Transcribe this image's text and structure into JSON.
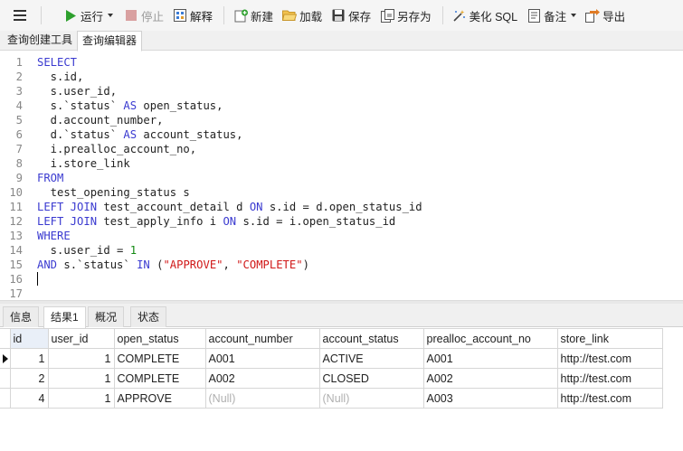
{
  "toolbar": {
    "menu_icon": "hamburger-menu-icon",
    "run_label": "运行",
    "stop_label": "停止",
    "explain_label": "解释",
    "new_label": "新建",
    "load_label": "加载",
    "save_label": "保存",
    "save_as_label": "另存为",
    "beautify_label": "美化 SQL",
    "comment_label": "备注",
    "export_label": "导出"
  },
  "tabs": {
    "builder": "查询创建工具",
    "editor": "查询编辑器"
  },
  "editor": {
    "line_numbers": [
      "1",
      "2",
      "3",
      "4",
      "5",
      "6",
      "7",
      "8",
      "9",
      "10",
      "11",
      "12",
      "13",
      "14",
      "15",
      "16",
      "17"
    ],
    "lines": [
      [
        {
          "t": "SELECT",
          "c": "kw"
        }
      ],
      [
        {
          "t": "  s.id,",
          "c": ""
        }
      ],
      [
        {
          "t": "  s.user_id,",
          "c": ""
        }
      ],
      [
        {
          "t": "  s.`status` ",
          "c": ""
        },
        {
          "t": "AS",
          "c": "kw"
        },
        {
          "t": " open_status,",
          "c": ""
        }
      ],
      [
        {
          "t": "  d.account_number,",
          "c": ""
        }
      ],
      [
        {
          "t": "  d.`status` ",
          "c": ""
        },
        {
          "t": "AS",
          "c": "kw"
        },
        {
          "t": " account_status,",
          "c": ""
        }
      ],
      [
        {
          "t": "  i.prealloc_account_no,",
          "c": ""
        }
      ],
      [
        {
          "t": "  i.store_link",
          "c": ""
        }
      ],
      [
        {
          "t": "FROM",
          "c": "kw"
        }
      ],
      [
        {
          "t": "  test_opening_status s",
          "c": ""
        }
      ],
      [
        {
          "t": "LEFT JOIN",
          "c": "kw"
        },
        {
          "t": " test_account_detail d ",
          "c": ""
        },
        {
          "t": "ON",
          "c": "kw"
        },
        {
          "t": " s.id = d.open_status_id",
          "c": ""
        }
      ],
      [
        {
          "t": "LEFT JOIN",
          "c": "kw"
        },
        {
          "t": " test_apply_info i ",
          "c": ""
        },
        {
          "t": "ON",
          "c": "kw"
        },
        {
          "t": " s.id = i.open_status_id",
          "c": ""
        }
      ],
      [
        {
          "t": "WHERE",
          "c": "kw"
        }
      ],
      [
        {
          "t": "  s.user_id = ",
          "c": ""
        },
        {
          "t": "1",
          "c": "num"
        }
      ],
      [
        {
          "t": "AND",
          "c": "kw"
        },
        {
          "t": " s.`status` ",
          "c": ""
        },
        {
          "t": "IN",
          "c": "kw"
        },
        {
          "t": " (",
          "c": ""
        },
        {
          "t": "\"APPROVE\"",
          "c": "str"
        },
        {
          "t": ", ",
          "c": ""
        },
        {
          "t": "\"COMPLETE\"",
          "c": "str"
        },
        {
          "t": ")",
          "c": ""
        }
      ],
      [
        {
          "t": "",
          "c": ""
        }
      ],
      [
        {
          "t": "",
          "c": ""
        }
      ]
    ]
  },
  "result_tabs": [
    "信息",
    "结果1",
    "概况",
    "状态"
  ],
  "result": {
    "columns": [
      "id",
      "user_id",
      "open_status",
      "account_number",
      "account_status",
      "prealloc_account_no",
      "store_link"
    ],
    "rows": [
      [
        "1",
        "1",
        "COMPLETE",
        "A001",
        "ACTIVE",
        "A001",
        "http://test.com"
      ],
      [
        "2",
        "1",
        "COMPLETE",
        "A002",
        "CLOSED",
        "A002",
        "http://test.com"
      ],
      [
        "4",
        "1",
        "APPROVE",
        "(Null)",
        "(Null)",
        "A003",
        "http://test.com"
      ]
    ]
  },
  "colors": {
    "keyword": "#3a3ad0",
    "string": "#d01818",
    "number": "#128a12",
    "null": "#b0b0b0"
  }
}
